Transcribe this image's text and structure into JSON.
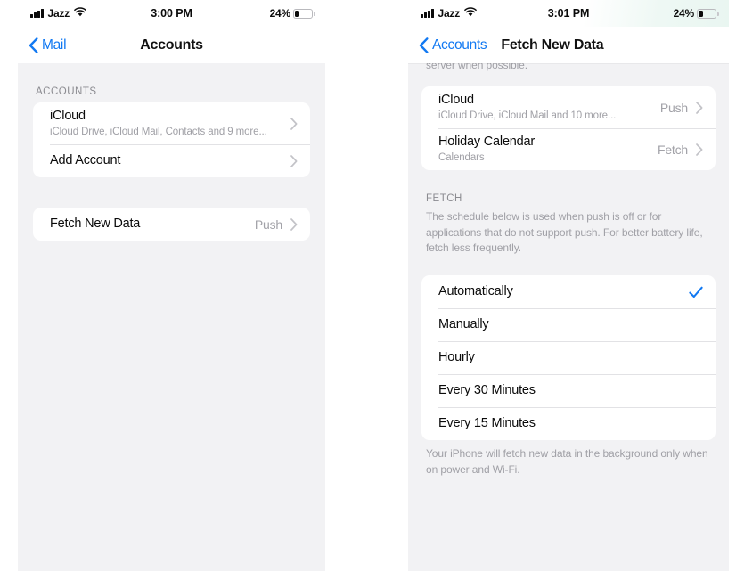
{
  "left_phone": {
    "status_bar": {
      "carrier": "Jazz",
      "time": "3:00 PM",
      "battery_percent": "24%",
      "signal_icon": "signal-bars-icon",
      "wifi_icon": "wifi-icon",
      "battery_icon": "battery-icon"
    },
    "nav": {
      "back_label": "Mail",
      "title": "Accounts",
      "back_icon": "chevron-left-icon"
    },
    "accounts_section": {
      "header": "ACCOUNTS",
      "rows": [
        {
          "title": "iCloud",
          "subtitle": "iCloud Drive, iCloud Mail, Contacts and 9 more...",
          "value": "",
          "accessory_icon": "chevron-right-icon"
        },
        {
          "title": "Add Account",
          "subtitle": "",
          "value": "",
          "accessory_icon": "chevron-right-icon"
        }
      ]
    },
    "fetch_section": {
      "rows": [
        {
          "title": "Fetch New Data",
          "subtitle": "",
          "value": "Push",
          "accessory_icon": "chevron-right-icon"
        }
      ]
    }
  },
  "right_phone": {
    "status_bar": {
      "carrier": "Jazz",
      "time": "3:01 PM",
      "battery_percent": "24%",
      "signal_icon": "signal-bars-icon",
      "wifi_icon": "wifi-icon",
      "battery_icon": "battery-icon"
    },
    "nav": {
      "back_label": "Accounts",
      "title": "Fetch New Data",
      "back_icon": "chevron-left-icon"
    },
    "scrolled_text": "server when possible.",
    "accounts_rows": [
      {
        "title": "iCloud",
        "subtitle": "iCloud Drive, iCloud Mail and 10 more...",
        "value": "Push",
        "accessory_icon": "chevron-right-icon"
      },
      {
        "title": "Holiday Calendar",
        "subtitle": "Calendars",
        "value": "Fetch",
        "accessory_icon": "chevron-right-icon"
      }
    ],
    "fetch_section": {
      "header": "FETCH",
      "description": "The schedule below is used when push is off or for applications that do not support push. For better battery life, fetch less frequently.",
      "options": [
        {
          "label": "Automatically",
          "selected": true
        },
        {
          "label": "Manually",
          "selected": false
        },
        {
          "label": "Hourly",
          "selected": false
        },
        {
          "label": "Every 30 Minutes",
          "selected": false
        },
        {
          "label": "Every 15 Minutes",
          "selected": false
        }
      ],
      "footnote": "Your iPhone will fetch new data in the background only when on power and Wi-Fi."
    }
  },
  "colors": {
    "accent_blue": "#1279f2",
    "checkmark_blue": "#1279f2",
    "background_gray": "#f2f2f4",
    "card_white": "#ffffff",
    "secondary_text": "#a0a0a6"
  }
}
